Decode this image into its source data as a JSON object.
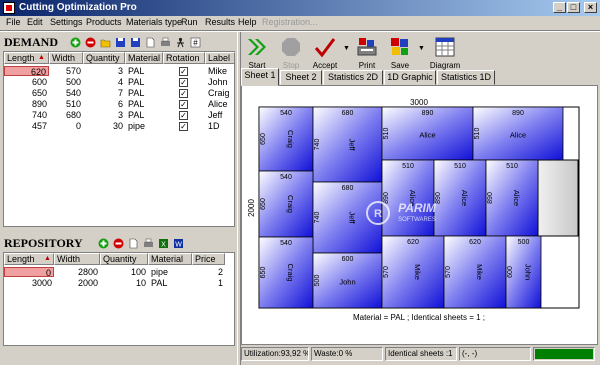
{
  "window": {
    "title": "Cutting Optimization Pro"
  },
  "menu": [
    "File",
    "Edit",
    "Settings",
    "Products",
    "Materials type",
    "Run",
    "Results",
    "Help",
    "Registration..."
  ],
  "demand": {
    "title": "DEMAND",
    "columns": [
      "Length",
      "Width",
      "Quantity",
      "Material",
      "Rotation",
      "Label"
    ],
    "rows": [
      {
        "length": "620",
        "width": "570",
        "quantity": "3",
        "material": "PAL",
        "rotation": true,
        "label": "Mike"
      },
      {
        "length": "600",
        "width": "500",
        "quantity": "4",
        "material": "PAL",
        "rotation": true,
        "label": "John"
      },
      {
        "length": "650",
        "width": "540",
        "quantity": "7",
        "material": "PAL",
        "rotation": true,
        "label": "Craig"
      },
      {
        "length": "890",
        "width": "510",
        "quantity": "6",
        "material": "PAL",
        "rotation": true,
        "label": "Alice"
      },
      {
        "length": "740",
        "width": "680",
        "quantity": "3",
        "material": "PAL",
        "rotation": true,
        "label": "Jeff"
      },
      {
        "length": "457",
        "width": "0",
        "quantity": "30",
        "material": "pipe",
        "rotation": true,
        "label": "1D"
      }
    ]
  },
  "repository": {
    "title": "REPOSITORY",
    "columns": [
      "Length",
      "Width",
      "Quantity",
      "Material",
      "Price"
    ],
    "rows": [
      {
        "length": "0",
        "width": "2800",
        "quantity": "100",
        "material": "pipe",
        "price": "2"
      },
      {
        "length": "3000",
        "width": "2000",
        "quantity": "10",
        "material": "PAL",
        "price": "1"
      }
    ]
  },
  "toolbar": {
    "start": "Start",
    "stop": "Stop",
    "accept": "Accept",
    "print": "Print",
    "save": "Save",
    "diagram": "Diagram"
  },
  "tabs": [
    "Sheet 1",
    "Sheet 2",
    "Statistics 2D",
    "1D Graphic",
    "Statistics 1D"
  ],
  "sheet": {
    "top_dim": "3000",
    "side_dim": "2000",
    "caption": "Material = PAL ; Identical sheets  = 1 ;",
    "watermark_title": "PARIM",
    "watermark_sub": "SOFTWARES",
    "pieces": [
      {
        "w": "540",
        "h": "650",
        "label": "Craig"
      },
      {
        "w": "680",
        "h": "740",
        "label": "Jeff"
      },
      {
        "w": "890",
        "h": "510",
        "label": "Alice"
      },
      {
        "w": "890",
        "h": "510",
        "label": "Alice"
      },
      {
        "w": "540",
        "h": "650",
        "label": "Craig"
      },
      {
        "w": "680",
        "h": "740",
        "label": "Jeff"
      },
      {
        "w": "510",
        "h": "890",
        "label": "Alice"
      },
      {
        "w": "510",
        "h": "890",
        "label": "Alice"
      },
      {
        "w": "510",
        "h": "890",
        "label": "Alice"
      },
      {
        "w": "540",
        "h": "650",
        "label": "Craig"
      },
      {
        "w": "600",
        "h": "500",
        "label": "John"
      },
      {
        "w": "620",
        "h": "570",
        "label": "Mike"
      },
      {
        "w": "620",
        "h": "570",
        "label": "Mike"
      },
      {
        "w": "500",
        "h": "600",
        "label": "John"
      }
    ]
  },
  "status": {
    "utilization": "Utilization:93,92 %",
    "waste": "Waste:0 %",
    "identical": "Identical sheets :1",
    "coords": "(-, -)"
  },
  "colors": {
    "accent": "#0a246a",
    "piece": "#2020e0",
    "progress": "#008000"
  }
}
